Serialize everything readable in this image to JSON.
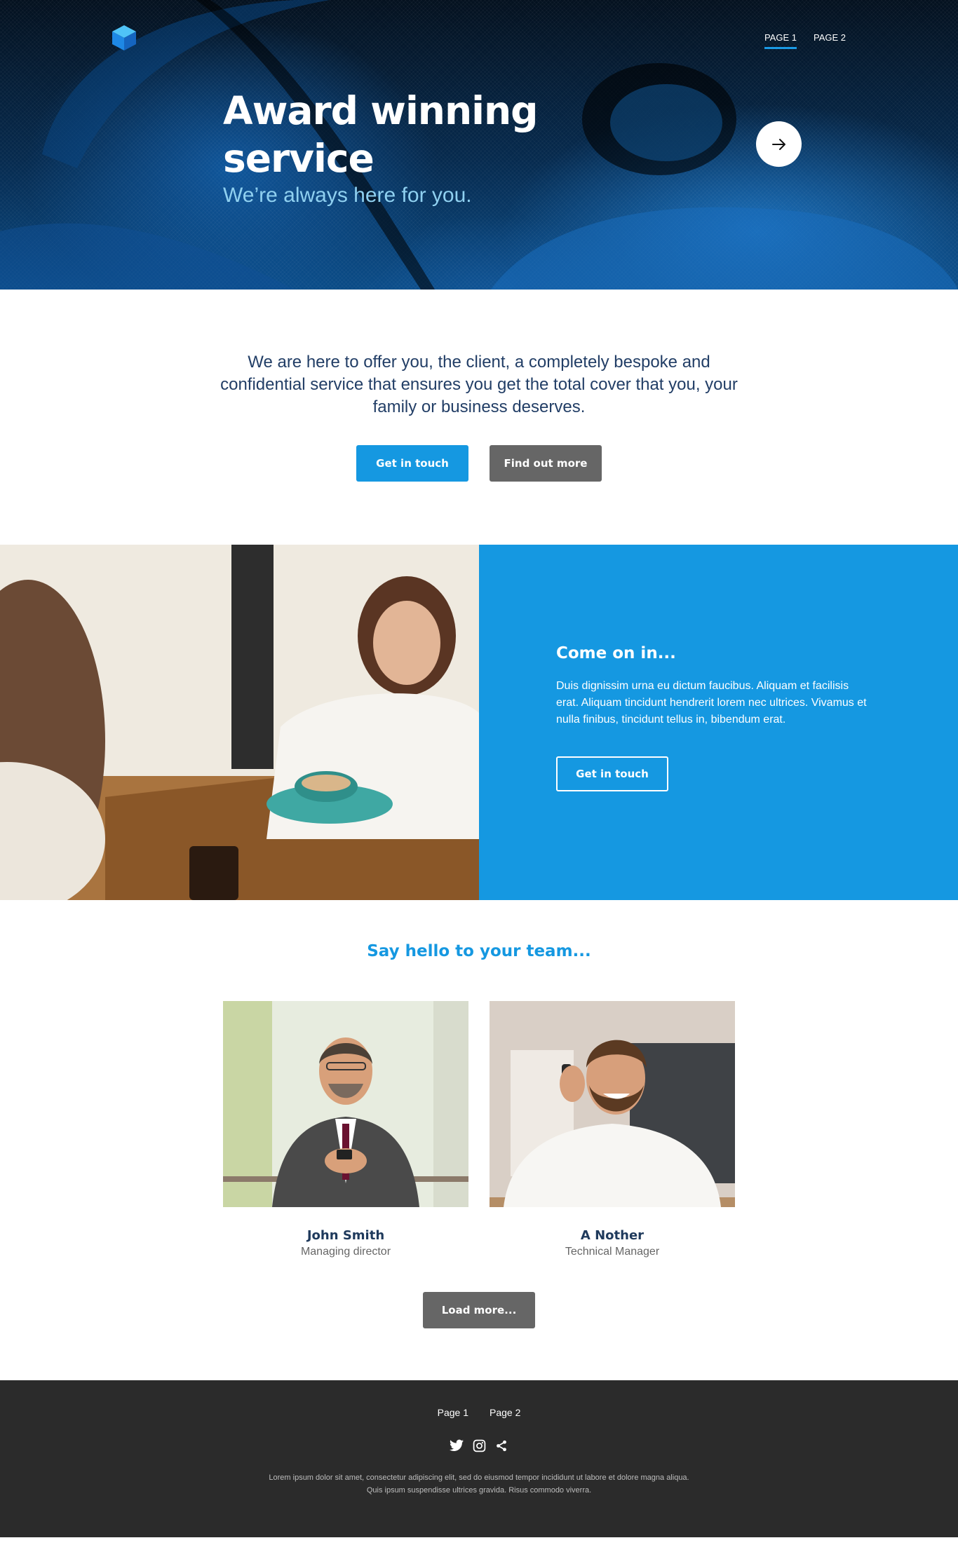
{
  "nav": {
    "items": [
      {
        "label": "PAGE 1",
        "active": true
      },
      {
        "label": "PAGE 2",
        "active": false
      }
    ]
  },
  "hero": {
    "title": "Award winning service",
    "subtitle": "We’re always here for you."
  },
  "intro": {
    "text": "We are here to offer you, the client, a completely bespoke and confidential service that ensures you get the total cover that you, your family or business deserves.",
    "primary_button": "Get in touch",
    "secondary_button": "Find out more"
  },
  "feature": {
    "title": "Come on in...",
    "text": "Duis dignissim urna eu dictum faucibus. Aliquam et facilisis erat. Aliquam tincidunt hendrerit lorem nec ultrices. Vivamus et nulla finibus, tincidunt tellus in, bibendum erat.",
    "button": "Get in touch"
  },
  "team": {
    "heading": "Say hello to your team...",
    "members": [
      {
        "name": "John Smith",
        "role": "Managing director"
      },
      {
        "name": "A Nother",
        "role": "Technical Manager"
      }
    ],
    "load_more": "Load more..."
  },
  "footer": {
    "links": [
      "Page 1",
      "Page 2"
    ],
    "social_icons": [
      "twitter-icon",
      "instagram-icon",
      "share-icon"
    ],
    "text": "Lorem ipsum dolor sit amet, consectetur adipiscing elit, sed do eiusmod tempor incididunt ut labore et dolore magna aliqua. Quis ipsum suspendisse ultrices gravida. Risus commodo viverra."
  },
  "colors": {
    "accent": "#1598e1",
    "button_grey": "#666666",
    "footer_bg": "#2b2b2b",
    "heading_navy": "#1f3a5c",
    "hero_subtitle": "#8fd0f0"
  }
}
